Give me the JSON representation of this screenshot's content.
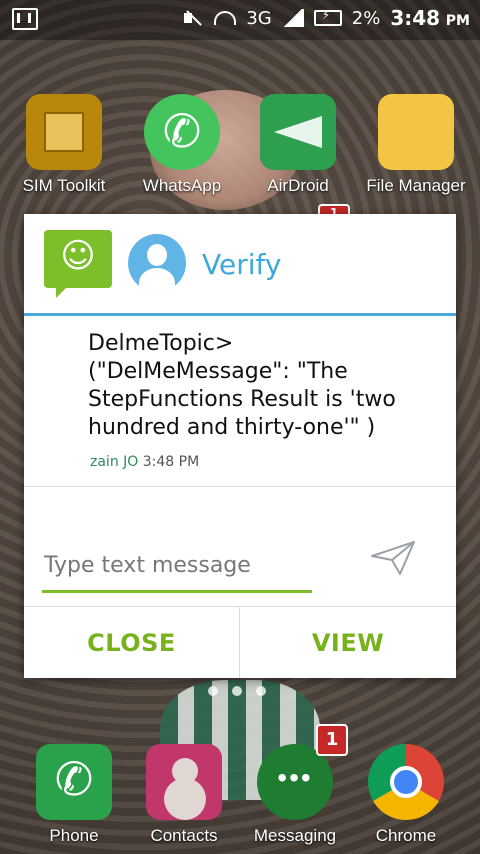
{
  "status_bar": {
    "network": "3G",
    "battery": "2%",
    "time": "3:48",
    "ampm": "PM"
  },
  "home_apps": {
    "sim_toolkit": "SIM Toolkit",
    "whatsapp": "WhatsApp",
    "airdroid": "AirDroid",
    "file_manager": "File Manager"
  },
  "dock": {
    "phone": "Phone",
    "contacts": "Contacts",
    "messaging": "Messaging",
    "messaging_badge": "1",
    "chrome": "Chrome"
  },
  "hidden_badge": "1",
  "dialog": {
    "title": "Verify",
    "message": "DelmeTopic> (\"DelMeMessage\": \"The StepFunctions Result is 'two hundred and thirty-one'\" )",
    "sender": "zain JO",
    "time": "3:48 PM",
    "input_placeholder": "Type text message",
    "close_label": "CLOSE",
    "view_label": "VIEW"
  },
  "colors": {
    "accent_green": "#77b21c",
    "title_blue": "#3ea8dc"
  }
}
